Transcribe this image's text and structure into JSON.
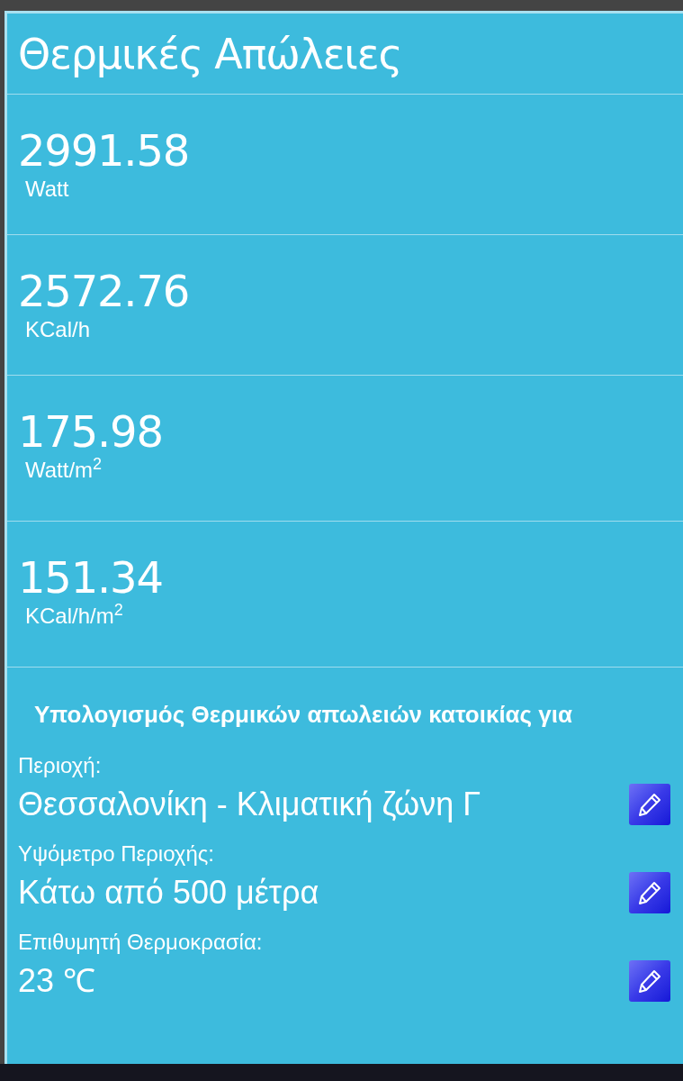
{
  "title": "Θερμικές Απώλειες",
  "results": [
    {
      "value": "2991.58",
      "unit": "Watt"
    },
    {
      "value": "2572.76",
      "unit": "KCal/h"
    },
    {
      "value": "175.98",
      "unit": "Watt/m$^{2}$"
    },
    {
      "value": "151.34",
      "unit": "KCal/h/m$^{2}$"
    }
  ],
  "section_heading": "Υπολογισμός Θερμικών απωλειών κατοικίας για",
  "fields": [
    {
      "label": "Περιοχή:",
      "value": "Θεσσαλονίκη - Κλιματική ζώνη Γ"
    },
    {
      "label": "Υψόμετρο Περιοχής:",
      "value": "Κάτω από 500 μέτρα"
    },
    {
      "label": "Επιθυμητή Θερμοκρασία:",
      "value": "23 ℃"
    }
  ]
}
